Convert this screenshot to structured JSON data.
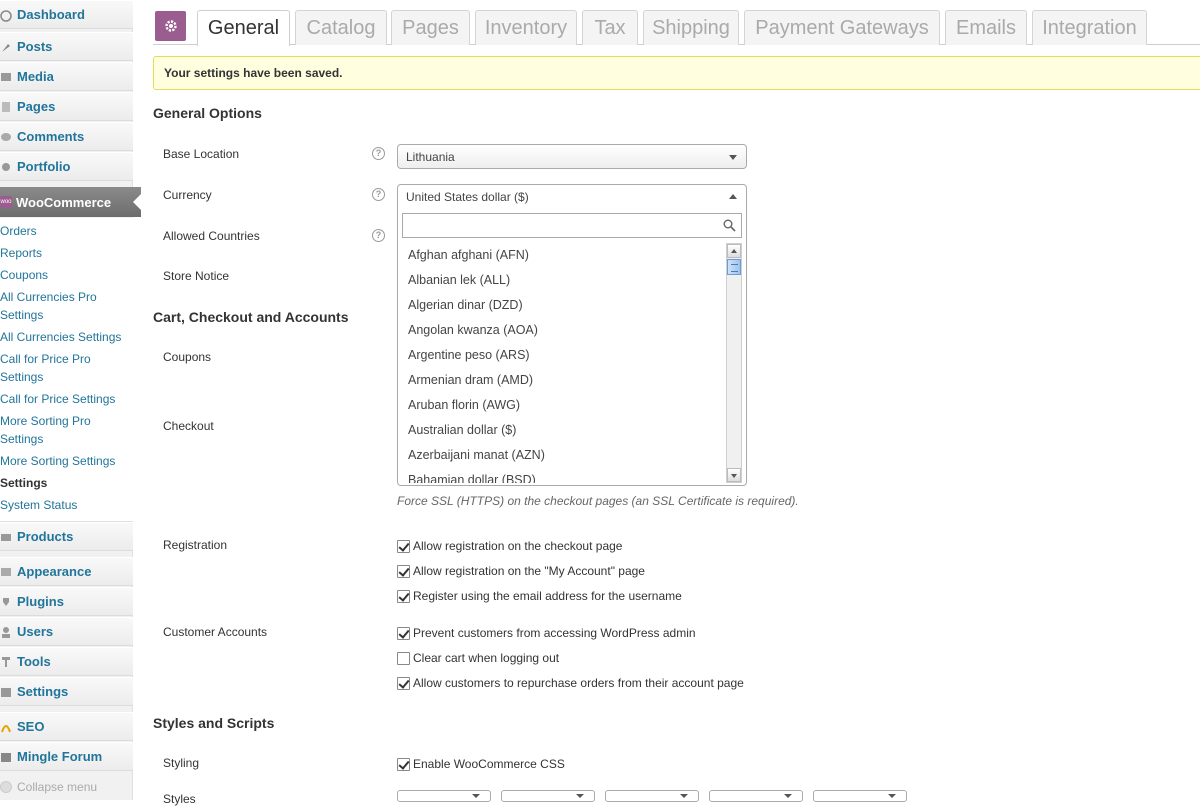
{
  "sidebar": {
    "top_items": [
      {
        "label": "Dashboard",
        "icon": "dashboard-icon"
      },
      {
        "label": "Posts",
        "icon": "pin-icon"
      },
      {
        "label": "Media",
        "icon": "media-icon"
      },
      {
        "label": "Pages",
        "icon": "page-icon"
      },
      {
        "label": "Comments",
        "icon": "comment-icon"
      },
      {
        "label": "Portfolio",
        "icon": "portfolio-icon"
      }
    ],
    "active": {
      "label": "WooCommerce",
      "icon_text": "woo"
    },
    "submenu": [
      "Orders",
      "Reports",
      "Coupons",
      "All Currencies Pro",
      "Settings",
      "All Currencies Settings",
      "Call for Price Pro",
      "Settings",
      "Call for Price Settings",
      "More Sorting Pro",
      "Settings",
      "More Sorting Settings",
      "Settings",
      "System Status"
    ],
    "bottom_items": [
      {
        "label": "Products",
        "icon": "products-icon"
      },
      {
        "label": "Appearance",
        "icon": "appearance-icon"
      },
      {
        "label": "Plugins",
        "icon": "plugin-icon"
      },
      {
        "label": "Users",
        "icon": "users-icon"
      },
      {
        "label": "Tools",
        "icon": "tools-icon"
      },
      {
        "label": "Settings",
        "icon": "settings-icon"
      },
      {
        "label": "SEO",
        "icon": "seo-icon"
      },
      {
        "label": "Mingle Forum",
        "icon": "forum-icon"
      }
    ],
    "collapse_label": "Collapse menu"
  },
  "tabs": [
    "General",
    "Catalog",
    "Pages",
    "Inventory",
    "Tax",
    "Shipping",
    "Payment Gateways",
    "Emails",
    "Integration"
  ],
  "active_tab": "General",
  "notice": "Your settings have been saved.",
  "sections": {
    "general": "General Options",
    "cart": "Cart, Checkout and Accounts",
    "styles": "Styles and Scripts"
  },
  "fields": {
    "base_location": {
      "label": "Base Location",
      "value": "Lithuania"
    },
    "currency": {
      "label": "Currency",
      "value": "United States dollar ($)"
    },
    "allowed_countries": {
      "label": "Allowed Countries"
    },
    "store_notice": {
      "label": "Store Notice"
    },
    "coupons": {
      "label": "Coupons"
    },
    "checkout": {
      "label": "Checkout",
      "hint": "Force SSL (HTTPS) on the checkout pages (an SSL Certificate is required)."
    },
    "registration": {
      "label": "Registration"
    },
    "customer_accounts": {
      "label": "Customer Accounts"
    },
    "styling": {
      "label": "Styling"
    },
    "styles": {
      "label": "Styles"
    }
  },
  "currency_dropdown": {
    "search_placeholder": "",
    "options": [
      "Afghan afghani (AFN)",
      "Albanian lek (ALL)",
      "Algerian dinar (DZD)",
      "Angolan kwanza (AOA)",
      "Argentine peso (ARS)",
      "Armenian dram (AMD)",
      "Aruban florin (AWG)",
      "Australian dollar ($)",
      "Azerbaijani manat (AZN)",
      "Bahamian dollar (BSD)"
    ]
  },
  "registration_options": [
    {
      "label": "Allow registration on the checkout page",
      "checked": true
    },
    {
      "label": "Allow registration on the \"My Account\" page",
      "checked": true
    },
    {
      "label": "Register using the email address for the username",
      "checked": true
    }
  ],
  "account_options": [
    {
      "label": "Prevent customers from accessing WordPress admin",
      "checked": true
    },
    {
      "label": "Clear cart when logging out",
      "checked": false
    },
    {
      "label": "Allow customers to repurchase orders from their account page",
      "checked": true
    }
  ],
  "styling_options": [
    {
      "label": "Enable WooCommerce CSS",
      "checked": true
    }
  ],
  "colors": {
    "link": "#21759b",
    "woo_purple": "#9b5c8f",
    "notice_bg": "#ffffe0",
    "notice_border": "#e6db55"
  }
}
